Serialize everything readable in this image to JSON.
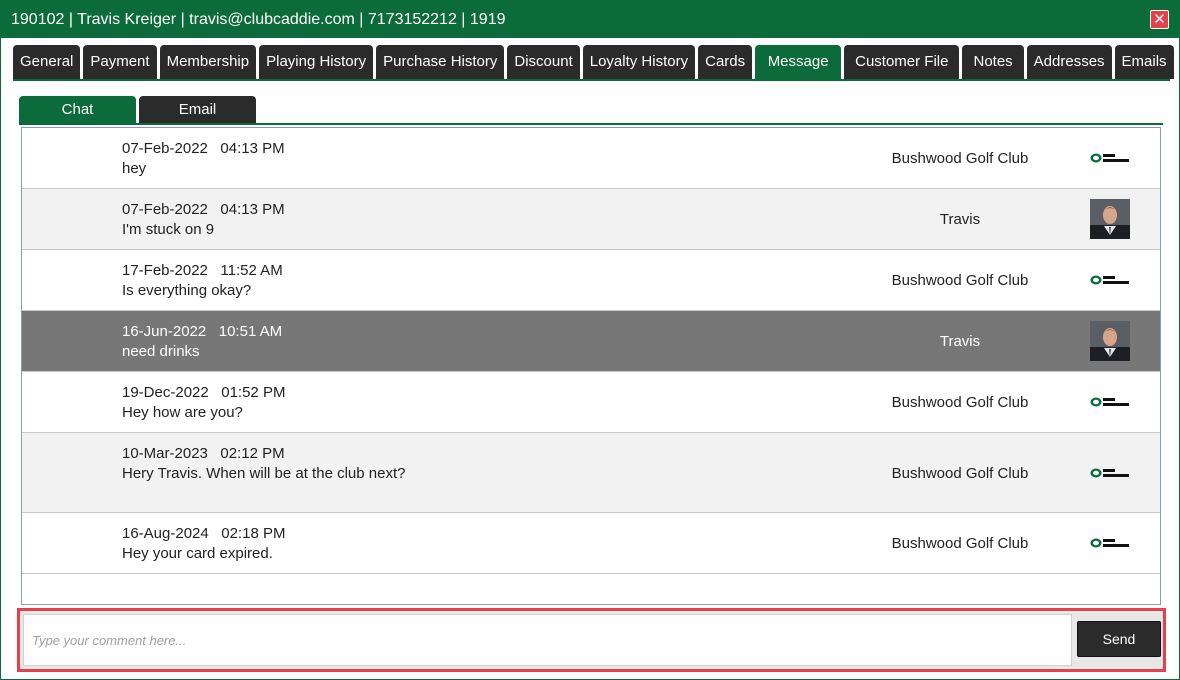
{
  "window": {
    "title": "190102 | Travis Kreiger | travis@clubcaddie.com | 7173152212 | 1919",
    "close_glyph": "✕"
  },
  "tabs": [
    {
      "label": "General",
      "active": false
    },
    {
      "label": "Payment",
      "active": false
    },
    {
      "label": "Membership",
      "active": false
    },
    {
      "label": "Playing History",
      "active": false
    },
    {
      "label": "Purchase History",
      "active": false
    },
    {
      "label": "Discount",
      "active": false
    },
    {
      "label": "Loyalty History",
      "active": false
    },
    {
      "label": "Cards",
      "active": false
    },
    {
      "label": "Message",
      "active": true
    },
    {
      "label": "Customer File",
      "active": false
    },
    {
      "label": "Notes",
      "active": false
    },
    {
      "label": "Addresses",
      "active": false
    },
    {
      "label": "Emails",
      "active": false
    }
  ],
  "subtabs": [
    {
      "label": "Chat",
      "active": true
    },
    {
      "label": "Email",
      "active": false
    }
  ],
  "messages": [
    {
      "date": "07-Feb-2022",
      "time": "04:13 PM",
      "text": "hey",
      "sender": "Bushwood Golf Club",
      "icon": "club-caddie-logo-icon"
    },
    {
      "date": "07-Feb-2022",
      "time": "04:13 PM",
      "text": "I'm stuck on 9",
      "sender": "Travis",
      "icon": "user-avatar-icon"
    },
    {
      "date": "17-Feb-2022",
      "time": "11:52 AM",
      "text": "Is everything okay?",
      "sender": "Bushwood Golf Club",
      "icon": "club-caddie-logo-icon"
    },
    {
      "date": "16-Jun-2022",
      "time": "10:51 AM",
      "text": "need drinks",
      "sender": "Travis",
      "icon": "user-avatar-icon",
      "selected": true
    },
    {
      "date": "19-Dec-2022",
      "time": "01:52 PM",
      "text": "Hey how are you?",
      "sender": "Bushwood Golf Club",
      "icon": "club-caddie-logo-icon"
    },
    {
      "date": "10-Mar-2023",
      "time": "02:12 PM",
      "text": "Hery Travis. When will be at the club next?",
      "sender": "Bushwood Golf Club",
      "icon": "club-caddie-logo-icon"
    },
    {
      "date": "16-Aug-2024",
      "time": "02:18 PM",
      "text": "Hey your card expired.",
      "sender": "Bushwood Golf Club",
      "icon": "club-caddie-logo-icon"
    }
  ],
  "composer": {
    "placeholder": "Type your comment here...",
    "value": "",
    "send_label": "Send"
  },
  "colors": {
    "brand_green": "#0b6b3a",
    "tab_dark": "#2b2b2b",
    "highlight_red": "#e8404a",
    "selected_row": "#777777"
  }
}
